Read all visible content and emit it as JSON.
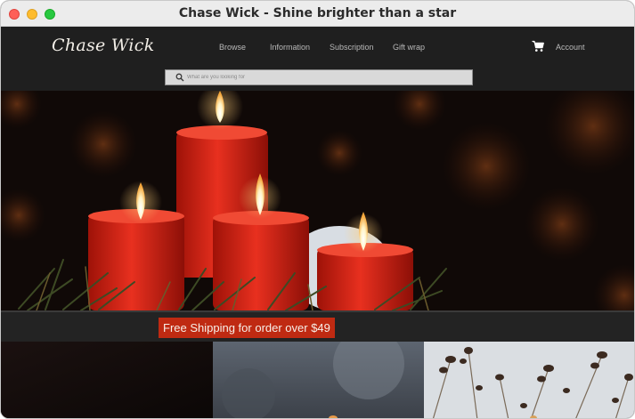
{
  "window": {
    "title": "Chase Wick - Shine brighter than a star"
  },
  "header": {
    "logo": "Chase Wick",
    "nav": [
      {
        "label": "Browse"
      },
      {
        "label": "Information"
      },
      {
        "label": "Subscription"
      },
      {
        "label": "Gift wrap"
      }
    ],
    "account_label": "Account",
    "cart_icon": "cart-icon"
  },
  "search": {
    "placeholder": "What are you looking for",
    "value": "",
    "icon": "search-icon"
  },
  "promo": {
    "text": "Free Shipping for order over $49"
  },
  "colors": {
    "header_bg": "#1f1f1f",
    "promo_bg": "#bf2a12",
    "candle_red": "#d8231a"
  }
}
